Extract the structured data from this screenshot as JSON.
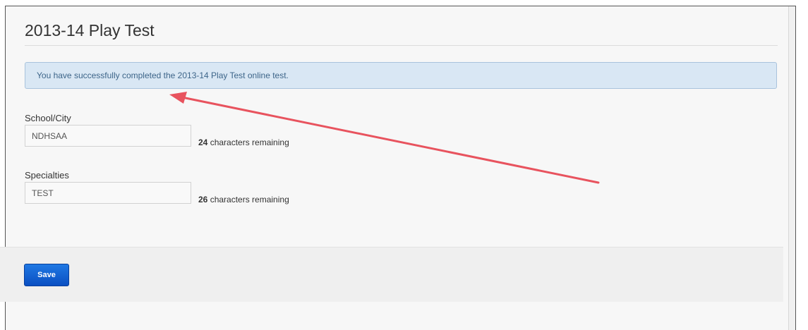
{
  "page": {
    "title": "2013-14 Play Test",
    "alert_message": "You have successfully completed the 2013-14 Play Test online test."
  },
  "form": {
    "fields": [
      {
        "label": "School/City",
        "value": "NDHSAA",
        "remaining_count": "24",
        "remaining_text": " characters remaining"
      },
      {
        "label": "Specialties",
        "value": "TEST",
        "remaining_count": "26",
        "remaining_text": " characters remaining"
      }
    ]
  },
  "footer": {
    "save_label": "Save"
  },
  "colors": {
    "alert_bg": "#d9e7f4",
    "alert_text": "#3d6589",
    "save_button": "#1464d4",
    "annotation_arrow": "#e8535e"
  }
}
